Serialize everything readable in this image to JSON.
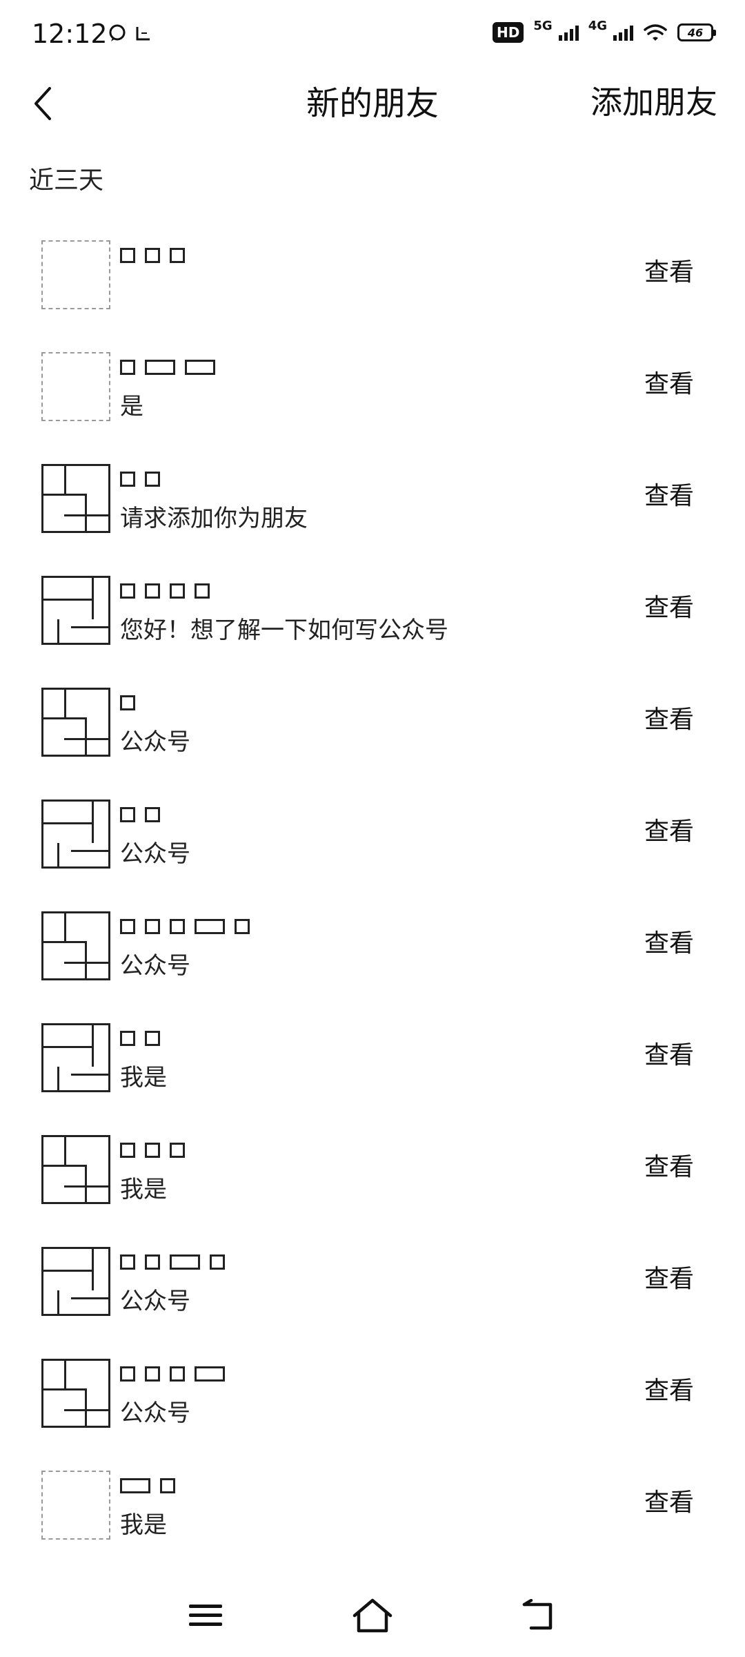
{
  "status_bar": {
    "time": "12:12",
    "hd_label": "HD",
    "sim1_label": "5G",
    "sim2_label": "4G",
    "battery_level": "46"
  },
  "header": {
    "title": "新的朋友",
    "add_friend_label": "添加朋友"
  },
  "section": {
    "label": "近三天"
  },
  "requests": [
    {
      "name": "",
      "message": "",
      "action": "查看"
    },
    {
      "name": "",
      "message": "是",
      "action": "查看"
    },
    {
      "name": "",
      "message": "请求添加你为朋友",
      "action": "查看"
    },
    {
      "name": "",
      "message": "您好！想了解一下如何写公众号",
      "action": "查看"
    },
    {
      "name": "",
      "message": "公众号",
      "action": "查看"
    },
    {
      "name": "",
      "message": "公众号",
      "action": "查看"
    },
    {
      "name": "",
      "message": "公众号",
      "action": "查看"
    },
    {
      "name": "",
      "message": "我是",
      "action": "查看"
    },
    {
      "name": "",
      "message": "我是",
      "action": "查看"
    },
    {
      "name": "",
      "message": "公众号",
      "action": "查看"
    },
    {
      "name": "",
      "message": "公众号",
      "action": "查看"
    },
    {
      "name": "",
      "message": "我是",
      "action": "查看"
    }
  ],
  "icons": {
    "back": "chevron-left-icon",
    "menu": "menu-icon",
    "home": "home-icon",
    "return": "return-icon"
  }
}
